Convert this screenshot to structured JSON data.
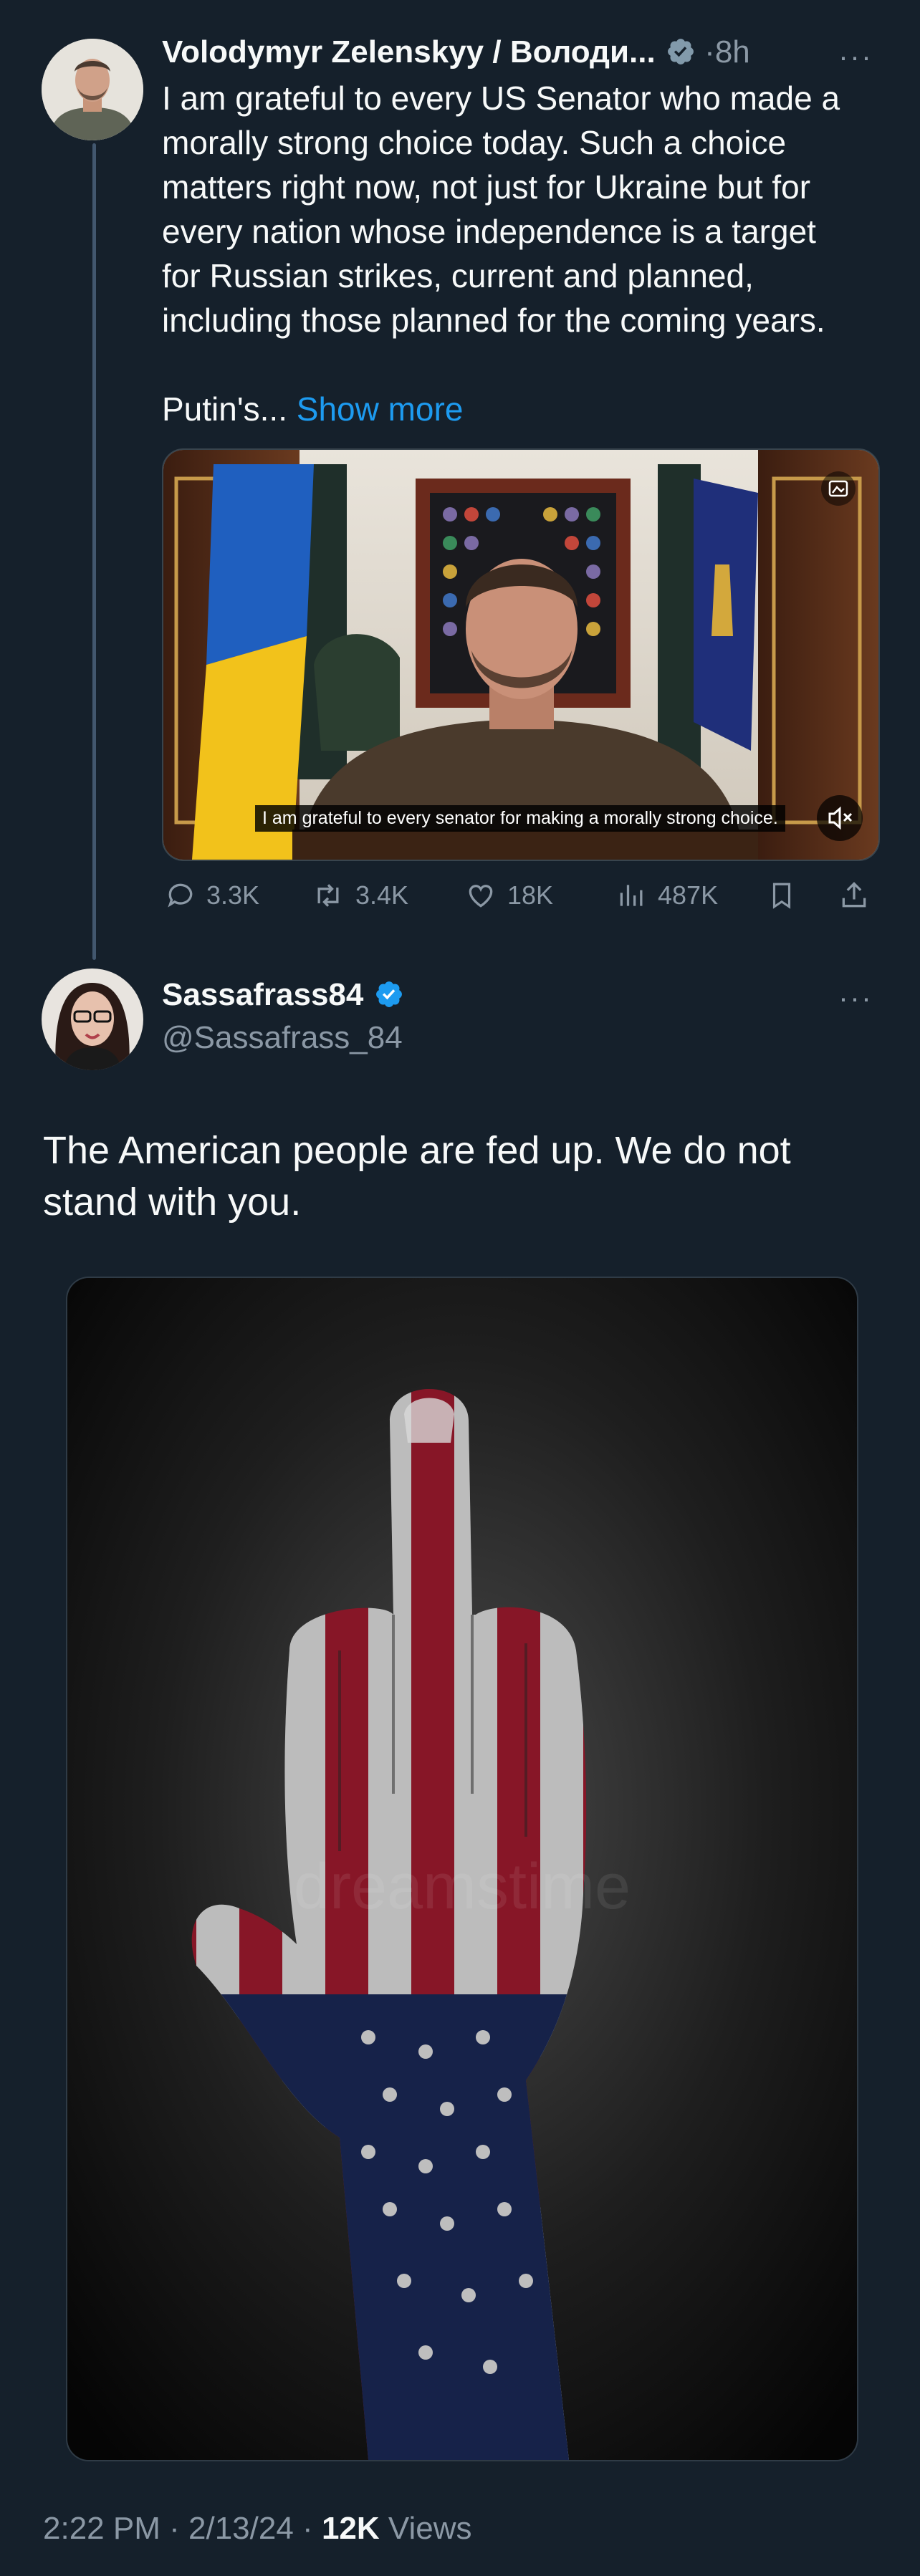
{
  "tweet1": {
    "author_name": "Volodymyr Zelenskyy / Володи...",
    "time": "8h",
    "separator": "·",
    "text_lines": [
      "I am grateful to every US Senator who made a",
      "morally strong choice today. Such a choice",
      "matters right now, not just for Ukraine but for",
      "every nation whose independence is a target",
      "for Russian strikes, current and planned,",
      "including those planned for the coming years."
    ],
    "text_tail": "Putin's...",
    "show_more": "Show more",
    "video_caption": "I am grateful to every senator for making a morally strong choice.",
    "stats": {
      "replies": "3.3K",
      "reposts": "3.4K",
      "likes": "18K",
      "views": "487K"
    }
  },
  "tweet2": {
    "author_name": "Sassafrass84",
    "handle": "@Sassafrass_84",
    "text_line1": "The American people are fed up. We do not",
    "text_line2": "stand with you.",
    "image_watermark": "dreamstime",
    "footer": {
      "time": "2:22 PM",
      "date": "2/13/24",
      "views_count": "12K",
      "views_label": "Views",
      "separator": "·"
    }
  },
  "more_menu": "···",
  "colors": {
    "background": "#15202b",
    "text": "#f7f9f9",
    "muted": "#8b98a5",
    "link": "#1d9bf0",
    "verified_blue": "#1d9bf0",
    "verified_gray": "#829aab",
    "thread_line": "#42576e"
  },
  "icons": [
    "verified-gray-icon",
    "verified-blue-icon",
    "reply-icon",
    "repost-icon",
    "like-icon",
    "views-icon",
    "bookmark-icon",
    "share-icon",
    "mute-icon",
    "gif-icon",
    "more-icon"
  ]
}
